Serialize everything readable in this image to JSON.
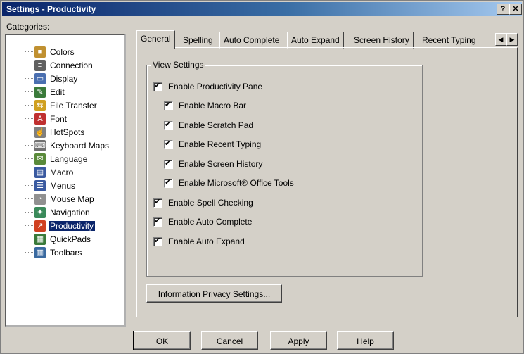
{
  "window": {
    "title": "Settings - Productivity",
    "help_glyph": "?",
    "close_glyph": "✕"
  },
  "categories": {
    "label": "Categories:",
    "items": [
      {
        "label": "Colors",
        "icon": "colors-icon",
        "color": "#c09030",
        "glyph": "■"
      },
      {
        "label": "Connection",
        "icon": "connection-icon",
        "color": "#606060",
        "glyph": "≡"
      },
      {
        "label": "Display",
        "icon": "display-icon",
        "color": "#4a6fb0",
        "glyph": "▭"
      },
      {
        "label": "Edit",
        "icon": "edit-icon",
        "color": "#3a7a3a",
        "glyph": "✎"
      },
      {
        "label": "File Transfer",
        "icon": "file-transfer-icon",
        "color": "#d0a020",
        "glyph": "⇆"
      },
      {
        "label": "Font",
        "icon": "font-icon",
        "color": "#c03030",
        "glyph": "A"
      },
      {
        "label": "HotSpots",
        "icon": "hotspots-icon",
        "color": "#808080",
        "glyph": "☝"
      },
      {
        "label": "Keyboard Maps",
        "icon": "keyboard-icon",
        "color": "#707070",
        "glyph": "⌨"
      },
      {
        "label": "Language",
        "icon": "language-icon",
        "color": "#5a8a3a",
        "glyph": "✉"
      },
      {
        "label": "Macro",
        "icon": "macro-icon",
        "color": "#3a5aa0",
        "glyph": "▤"
      },
      {
        "label": "Menus",
        "icon": "menus-icon",
        "color": "#3a5aa0",
        "glyph": "☰"
      },
      {
        "label": "Mouse Map",
        "icon": "mouse-icon",
        "color": "#909090",
        "glyph": "◔"
      },
      {
        "label": "Navigation",
        "icon": "navigation-icon",
        "color": "#3a8a5a",
        "glyph": "✦"
      },
      {
        "label": "Productivity",
        "icon": "productivity-icon",
        "color": "#d04020",
        "glyph": "↗"
      },
      {
        "label": "QuickPads",
        "icon": "quickpads-icon",
        "color": "#3a7a3a",
        "glyph": "▦"
      },
      {
        "label": "Toolbars",
        "icon": "toolbars-icon",
        "color": "#3a6aa0",
        "glyph": "▥"
      }
    ],
    "selected": "Productivity"
  },
  "tabs": [
    "General",
    "Spelling",
    "Auto Complete",
    "Auto Expand",
    "Screen History",
    "Recent Typing"
  ],
  "active_tab": "General",
  "tab_scroll": {
    "left": "◀",
    "right": "▶"
  },
  "view_settings": {
    "title": "View Settings",
    "options": [
      {
        "label": "Enable Productivity Pane",
        "checked": true
      },
      {
        "label": "Enable Macro Bar",
        "checked": true
      },
      {
        "label": "Enable Scratch Pad",
        "checked": true
      },
      {
        "label": "Enable Recent Typing",
        "checked": true
      },
      {
        "label": "Enable Screen History",
        "checked": true
      },
      {
        "label": "Enable Microsoft® Office Tools",
        "checked": true
      },
      {
        "label": "Enable Spell Checking",
        "checked": true
      },
      {
        "label": "Enable Auto Complete",
        "checked": true
      },
      {
        "label": "Enable Auto Expand",
        "checked": true
      }
    ]
  },
  "privacy_button": "Information Privacy Settings...",
  "buttons": {
    "ok": "OK",
    "cancel": "Cancel",
    "apply": "Apply",
    "help": "Help"
  }
}
